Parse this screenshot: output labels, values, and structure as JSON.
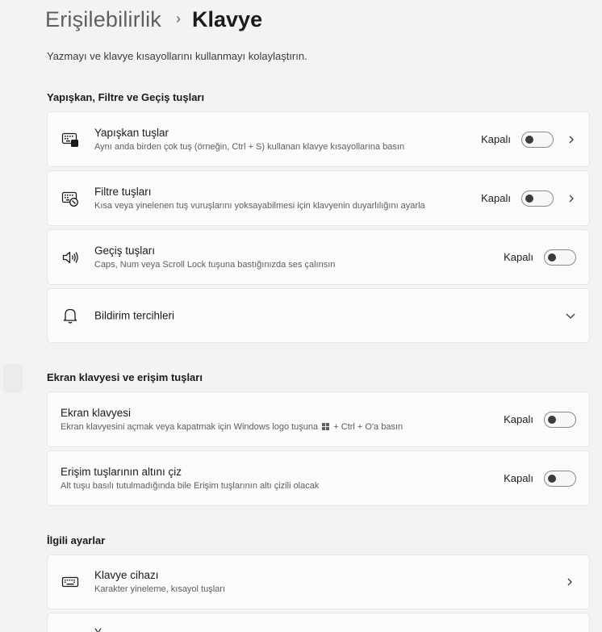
{
  "breadcrumb": {
    "parent": "Erişilebilirlik",
    "separator": "›",
    "current": "Klavye"
  },
  "subtitle": "Yazmayı ve klavye kısayollarını kullanmayı kolaylaştırın.",
  "sections": {
    "sticky": {
      "title": "Yapışkan, Filtre ve Geçiş tuşları"
    },
    "onscreen": {
      "title": "Ekran klavyesi ve erişim tuşları"
    },
    "related": {
      "title": "İlgili ayarlar"
    }
  },
  "cards": {
    "sticky_keys": {
      "title": "Yapışkan tuşlar",
      "desc": "Aynı anda birden çok tuş (örneğin, Ctrl + S) kullanan klavye kısayollarına basın",
      "state": "Kapalı",
      "on": false,
      "icon": "sticky-keys-icon"
    },
    "filter_keys": {
      "title": "Filtre tuşları",
      "desc": "Kısa veya yinelenen tuş vuruşlarını yoksayabilmesi için klavyenin duyarlılığını ayarla",
      "state": "Kapalı",
      "on": false,
      "icon": "filter-keys-icon"
    },
    "toggle_keys": {
      "title": "Geçiş tuşları",
      "desc": "Caps, Num veya Scroll Lock tuşuna bastığınızda ses çalınsın",
      "state": "Kapalı",
      "on": false,
      "icon": "speaker-icon"
    },
    "notifications": {
      "title": "Bildirim tercihleri",
      "icon": "bell-icon"
    },
    "onscreen_keyboard": {
      "title": "Ekran klavyesi",
      "desc_before": "Ekran klavyesini açmak veya kapatmak için Windows logo tuşuna",
      "desc_after": "+ Ctrl + O'a basın",
      "state": "Kapalı",
      "on": false
    },
    "access_keys": {
      "title": "Erişim tuşlarının altını çiz",
      "desc": "Alt tuşu basılı tutulmadığında bile Erişim tuşlarının altı çizili olacak",
      "state": "Kapalı",
      "on": false
    },
    "keyboard_device": {
      "title": "Klavye cihazı",
      "desc": "Karakter yineleme, kısayol tuşları",
      "icon": "keyboard-icon"
    },
    "partial": {
      "title": "Y"
    }
  },
  "colors": {
    "background": "#f3f3f3",
    "card": "#fbfbfb",
    "border": "#e5e5e5",
    "text": "#1b1b1b",
    "secondary_text": "#5d5d5d"
  }
}
